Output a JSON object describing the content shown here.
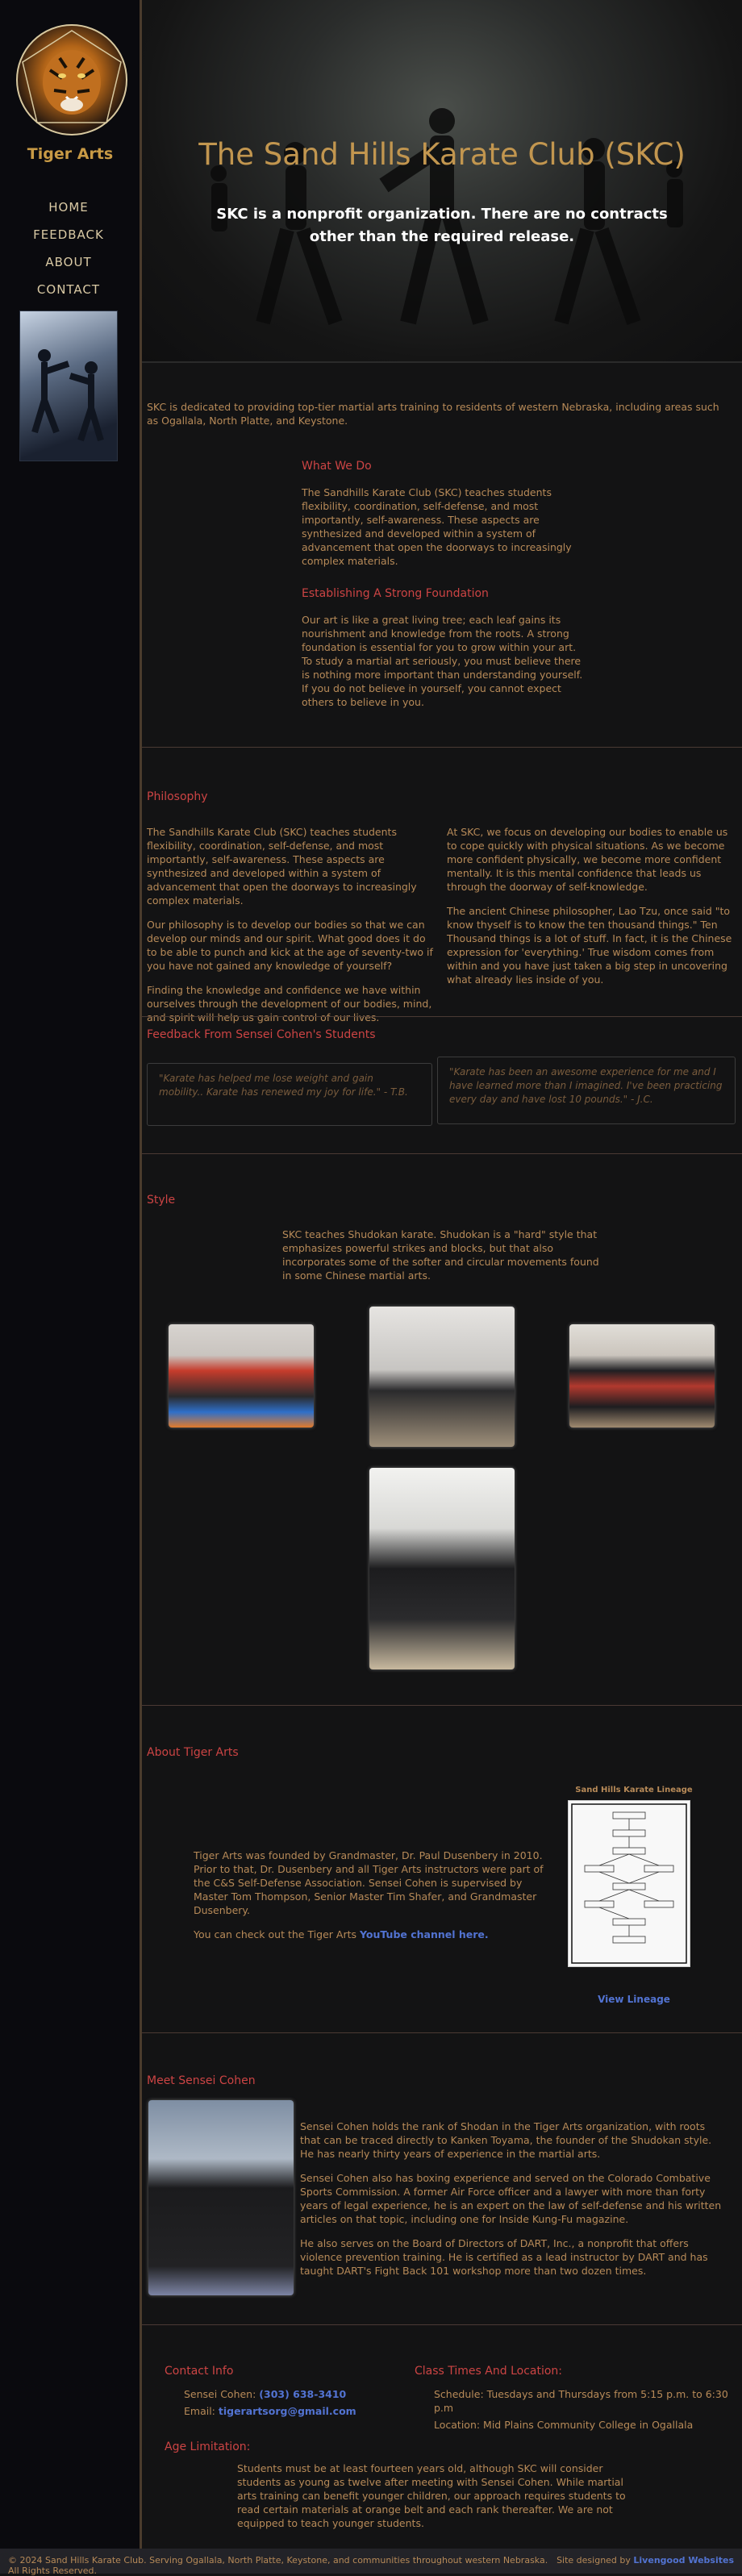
{
  "sidebar": {
    "logo_text": "Tiger Arts",
    "nav": [
      "HOME",
      "FEEDBACK",
      "ABOUT",
      "CONTACT"
    ]
  },
  "hero": {
    "title": "The Sand Hills Karate Club (SKC)",
    "subtitle": "SKC is a nonprofit organization. There are no contracts other than the required release."
  },
  "intro": {
    "text": "SKC is dedicated to providing top-tier martial arts training to residents of western Nebraska, including areas such as Ogallala, North Platte, and Keystone.",
    "what_we_do": {
      "heading": "What We Do",
      "text": "The Sandhills Karate Club (SKC) teaches students flexibility, coordination, self-defense, and most importantly, self-awareness. These aspects are synthesized and developed within a system of advancement that open the doorways to increasingly complex materials."
    },
    "foundation": {
      "heading": "Establishing A Strong Foundation",
      "text": "Our art is like a great living tree; each leaf gains its nourishment and knowledge from the roots. A strong foundation is essential for you to grow within your art. To study a martial art seriously, you must believe there is nothing more important than understanding yourself. If you do not believe in yourself, you cannot expect others to believe in you."
    }
  },
  "philosophy": {
    "heading": "Philosophy",
    "left": [
      "The Sandhills Karate Club (SKC) teaches students flexibility, coordination, self-defense, and most importantly, self-awareness. These aspects are synthesized and developed within a system of advancement that open the doorways to increasingly complex materials.",
      "Our philosophy is to develop our bodies so that we can develop our minds and our spirit. What good does it do to be able to punch and kick at the age of seventy-two if you have not gained any knowledge of yourself?",
      "Finding the knowledge and confidence we have within ourselves through the development of our bodies, mind, and spirit will help us gain control of our lives."
    ],
    "right": [
      "At SKC, we focus on developing our bodies to enable us to cope quickly with physical situations. As we become more confident physically, we become more confident mentally. It is this mental confidence that leads us through the doorway of self-knowledge.",
      "The ancient Chinese philosopher, Lao Tzu, once said \"to know thyself is to know the ten thousand things.\" Ten Thousand things is a lot of stuff. In fact, it is the Chinese expression for 'everything.' True wisdom comes from within and you have just taken a big step in uncovering what already lies inside of you."
    ]
  },
  "feedback": {
    "heading": "Feedback From Sensei Cohen's Students",
    "quotes": [
      "\"Karate has helped me lose weight and gain mobility.. Karate has renewed my joy for life.\" - T.B.",
      "\"Karate has been an awesome experience for me and I have learned more than I imagined. I've been practicing every day and have lost 10 pounds.\" - J.C."
    ]
  },
  "style": {
    "heading": "Style",
    "text": "SKC teaches Shudokan karate. Shudokan is a \"hard\" style that emphasizes powerful strikes and blocks, but that also incorporates some of the softer and circular movements found in some Chinese martial arts."
  },
  "about": {
    "heading": "About Tiger Arts",
    "text": "Tiger Arts was founded by Grandmaster, Dr. Paul Dusenbery in 2010. Prior to that, Dr. Dusenbery and all Tiger Arts instructors were part of the C&S Self-Defense Association. Sensei Cohen is supervised by Master Tom Thompson, Senior Master Tim Shafer, and Grandmaster Dusenbery.",
    "youtube_prefix": "You can check out the Tiger Arts ",
    "youtube_link": "YouTube channel here.",
    "lineage_title": "Sand Hills Karate Lineage",
    "view_lineage": "View Lineage"
  },
  "sensei": {
    "heading": "Meet Sensei Cohen",
    "paragraphs": [
      "Sensei Cohen holds the rank of Shodan in the Tiger Arts organization, with roots that can be traced directly to Kanken Toyama, the founder of the Shudokan style. He has nearly thirty years of experience in the martial arts.",
      "Sensei Cohen also has boxing experience and served on the Colorado Combative Sports Commission. A former Air Force officer and a lawyer with more than forty years of legal experience, he is an expert on the law of self-defense and his written articles on that topic, including one for Inside Kung-Fu magazine.",
      "He also serves on the Board of Directors of DART, Inc., a nonprofit that offers violence prevention training. He is certified as a lead instructor by DART and has taught DART's Fight Back 101 workshop more than two dozen times."
    ]
  },
  "contact": {
    "heading": "Contact Info",
    "sensei_label": "Sensei Cohen: ",
    "phone": "(303) 638-3410",
    "email_label": "Email: ",
    "email": "tigerartsorg@gmail.com",
    "class_heading": "Class Times And Location:",
    "schedule": "Schedule: Tuesdays and Thursdays from 5:15 p.m. to 6:30 p.m",
    "location": "Location: Mid Plains Community College in Ogallala",
    "age_heading": "Age Limitation:",
    "age_text": "Students must be at least fourteen years old, although SKC will consider students as young as twelve after meeting with Sensei Cohen. While martial arts training can benefit younger children, our approach requires students to read certain materials at orange belt and each rank thereafter. We are not equipped to teach younger students."
  },
  "footer": {
    "copyright": "© 2024 Sand Hills Karate Club. Serving Ogallala, North Platte, Keystone, and communities throughout western Nebraska. All Rights Reserved.",
    "designed_prefix": "Site designed by ",
    "designed_by": "Livengood Websites"
  }
}
